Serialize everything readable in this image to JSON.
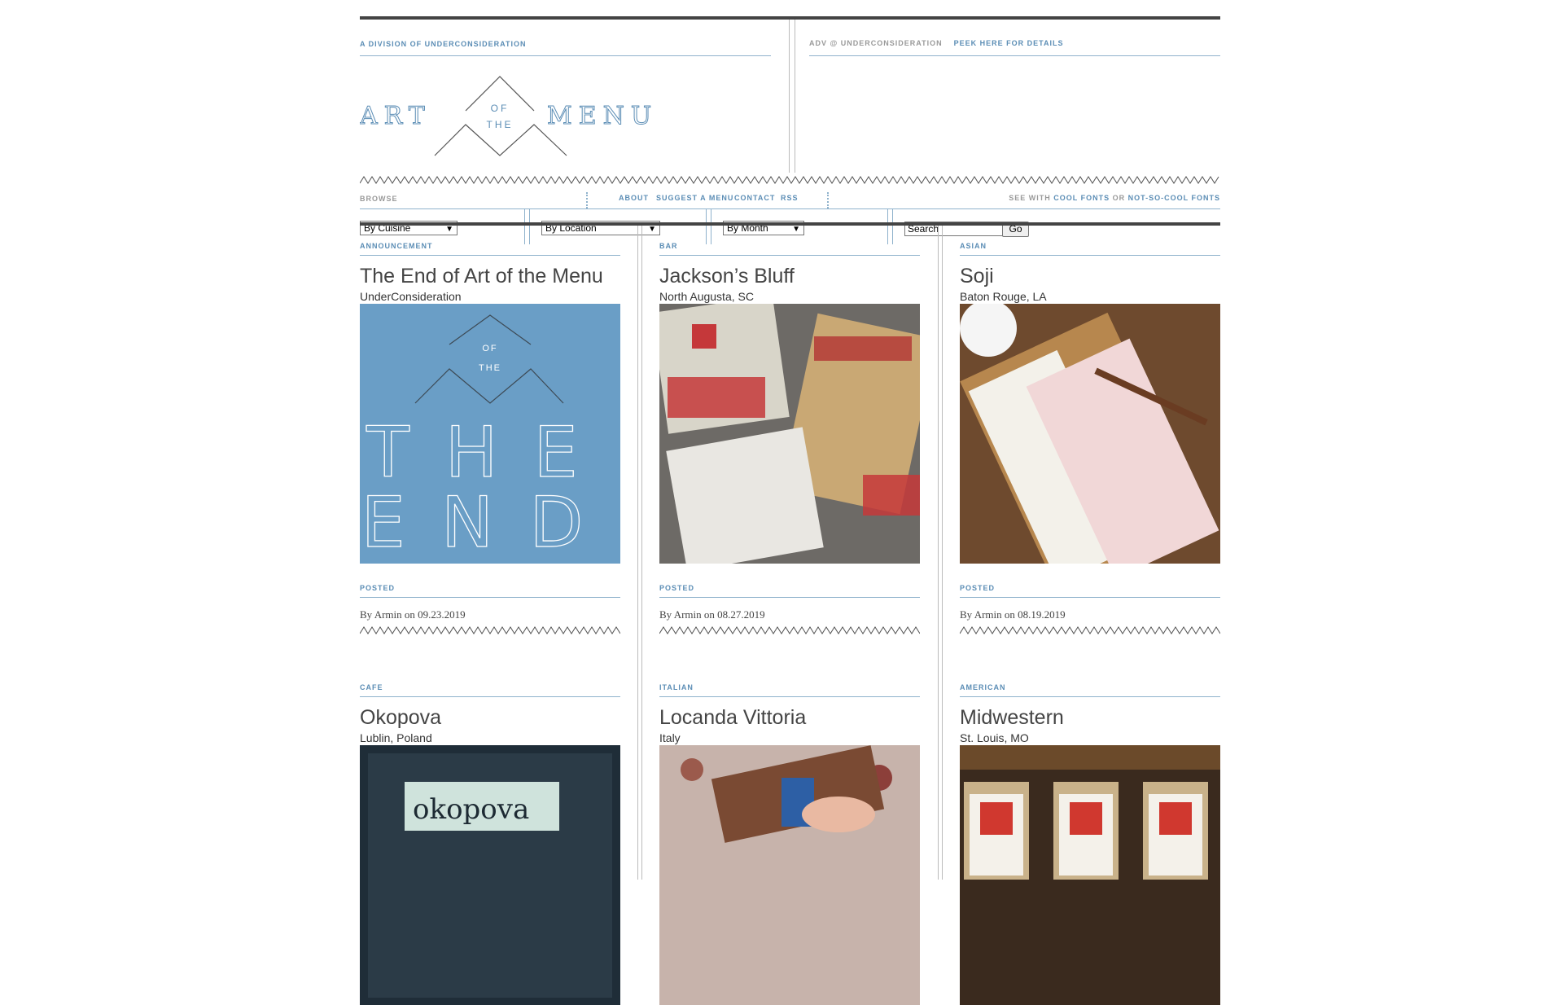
{
  "header": {
    "division": "A DIVISION OF UNDERCONSIDERATION",
    "adv": "ADV @ UNDERCONSIDERATION",
    "peek": "PEEK HERE FOR DETAILS",
    "logo": {
      "left": "ART",
      "of": "OF",
      "the": "THE",
      "right": "MENU"
    }
  },
  "browse": {
    "label": "BROWSE",
    "nav": [
      "ABOUT",
      "SUGGEST A MENU",
      "CONTACT",
      "RSS"
    ],
    "fonts_prefix": "SEE WITH",
    "fonts_cool": "COOL FONTS",
    "fonts_or": "OR",
    "fonts_notcool": "NOT-SO-COOL FONTS",
    "selects": [
      "By Cuisine",
      "By Location",
      "By Month"
    ],
    "search_value": "Search",
    "go_label": "Go"
  },
  "cards": [
    {
      "category": "ANNOUNCEMENT",
      "title": "The End of Art of the Menu",
      "location": "UnderConsideration",
      "posted_label": "POSTED",
      "byline": "By Armin on 09.23.2019",
      "image": {
        "of": "OF",
        "the": "THE",
        "line1": "THE",
        "line2": "END"
      }
    },
    {
      "category": "BAR",
      "title": "Jackson’s Bluff",
      "location": "North Augusta, SC",
      "posted_label": "POSTED",
      "byline": "By Armin on 08.27.2019"
    },
    {
      "category": "ASIAN",
      "title": "Soji",
      "location": "Baton Rouge, LA",
      "posted_label": "POSTED",
      "byline": "By Armin on 08.19.2019"
    },
    {
      "category": "CAFE",
      "title": "Okopova",
      "location": "Lublin, Poland",
      "image_text": "okopova"
    },
    {
      "category": "ITALIAN",
      "title": "Locanda Vittoria",
      "location": "Italy"
    },
    {
      "category": "AMERICAN",
      "title": "Midwestern",
      "location": "St. Louis, MO"
    }
  ],
  "colors": {
    "accent": "#5b8db5",
    "rule": "#8fb2cc",
    "bar": "#444444",
    "end_bg": "#6a9ec6"
  }
}
